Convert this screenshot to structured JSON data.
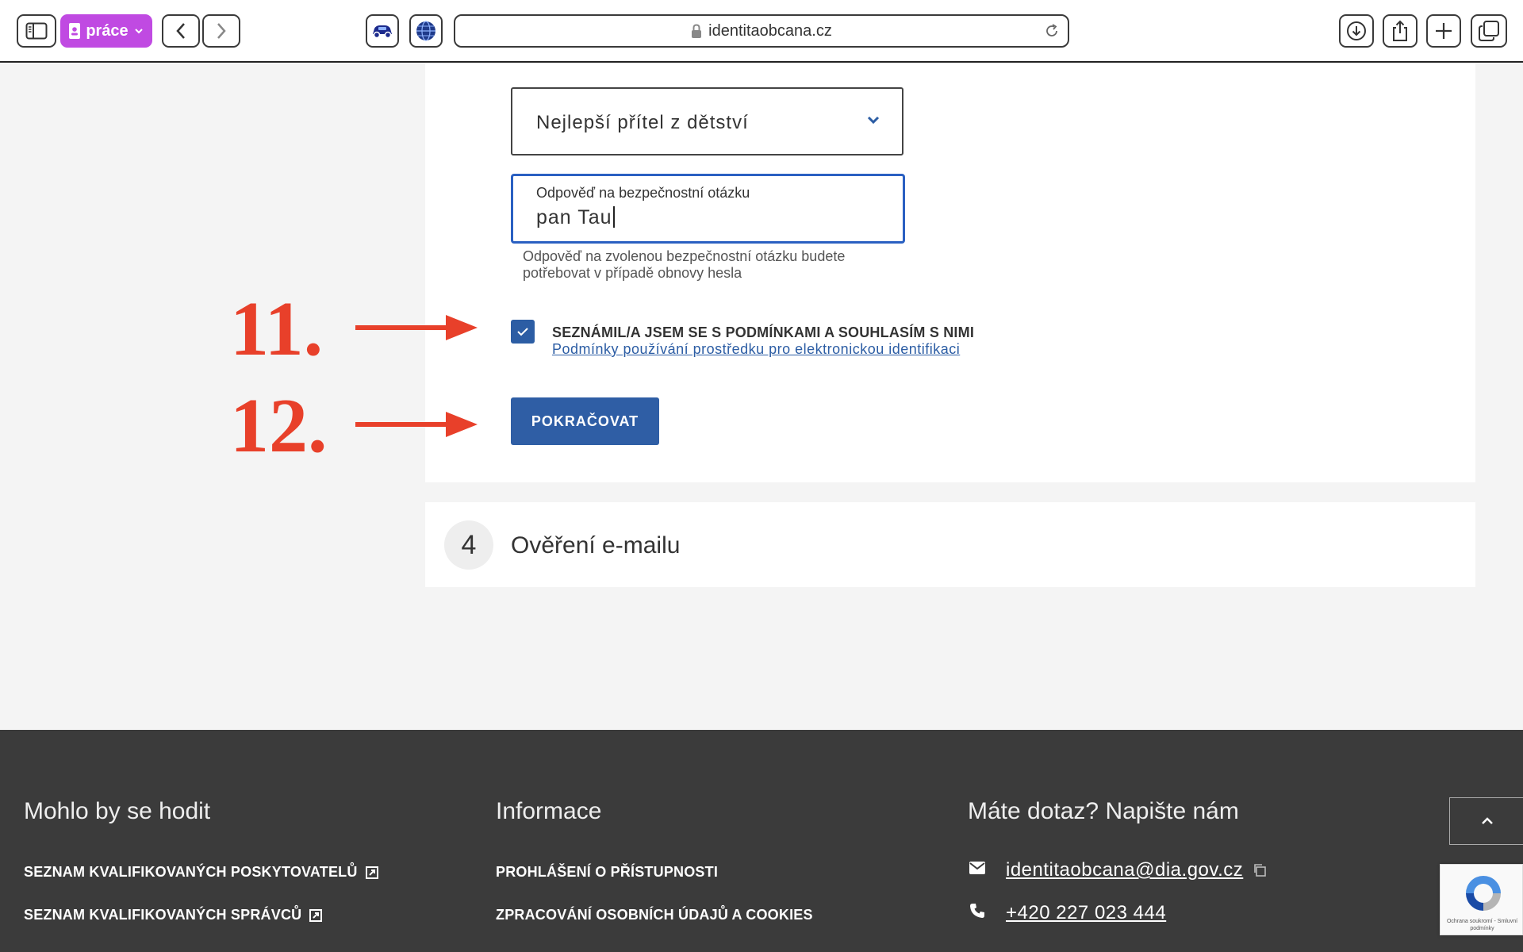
{
  "browser": {
    "profile_label": "práce",
    "url": "identitaobcana.cz"
  },
  "form": {
    "security_question": "Nejlepší přítel z dětství",
    "answer_label": "Odpověď na bezpečnostní otázku",
    "answer_value": "pan Tau",
    "answer_hint": "Odpověď na zvolenou bezpečnostní otázku budete potřebovat v případě obnovy hesla",
    "terms_checked": true,
    "terms_title": "SEZNÁMIL/A JSEM SE S PODMÍNKAMI A SOUHLASÍM S NIMI",
    "terms_link": "Podmínky používání prostředku pro elektronickou identifikaci",
    "continue_label": "POKRAČOVAT"
  },
  "next_step": {
    "number": "4",
    "title": "Ověření e-mailu"
  },
  "annotations": {
    "step_a": "11.",
    "step_b": "12.",
    "color": "#e8402a"
  },
  "footer": {
    "col1_heading": "Mohlo by se hodit",
    "col1_links": [
      "SEZNAM KVALIFIKOVANÝCH POSKYTOVATELŮ",
      "SEZNAM KVALIFIKOVANÝCH SPRÁVCŮ"
    ],
    "col2_heading": "Informace",
    "col2_links": [
      "PROHLÁŠENÍ O PŘÍSTUPNOSTI",
      "ZPRACOVÁNÍ OSOBNÍCH ÚDAJŮ A COOKIES"
    ],
    "col3_heading": "Máte dotaz? Napište nám",
    "email": "identitaobcana@dia.gov.cz",
    "phone": "+420 227 023 444"
  },
  "recaptcha": {
    "text": "Ochrana soukromí - Smluvní podmínky"
  },
  "colors": {
    "primary": "#2f5ea5",
    "focus_border": "#2a60c2",
    "footer_bg": "#3b3b3b",
    "profile_purple": "#c04ae2"
  }
}
